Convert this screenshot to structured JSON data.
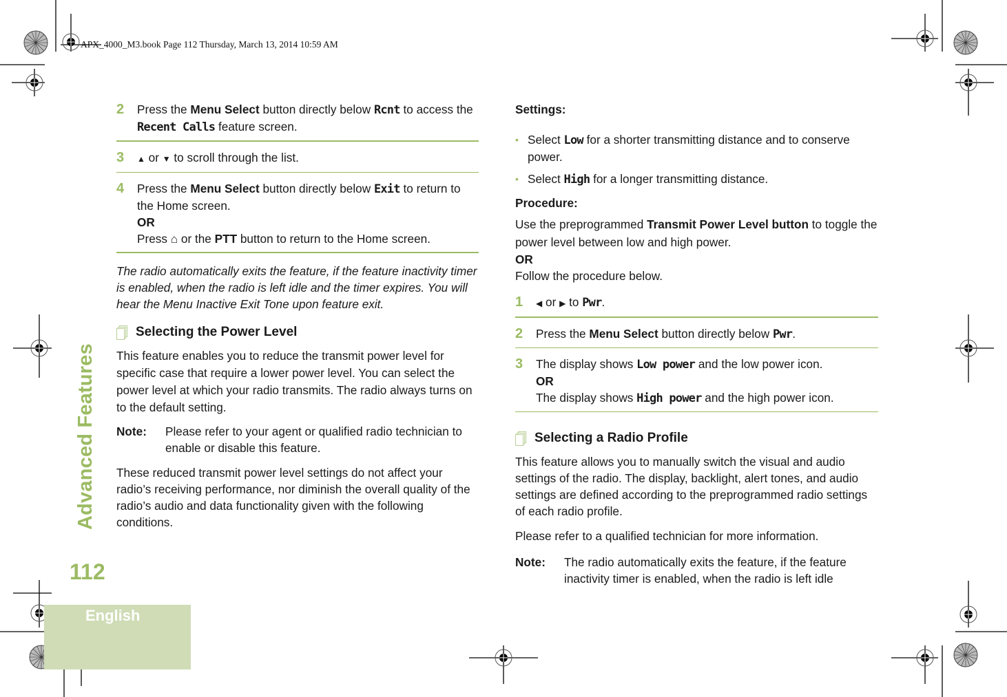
{
  "print_header": "APX_4000_M3.book  Page 112  Thursday, March 13, 2014  10:59 AM",
  "side_title": "Advanced Features",
  "page_number": "112",
  "language_tab": "English",
  "colors": {
    "accent_green": "#9bbb62",
    "lang_box": "#cfdcb6"
  },
  "left": {
    "steps": [
      {
        "num": "2",
        "parts": [
          "Press the ",
          "Menu Select",
          " button directly below ",
          "Rcnt",
          " to access the ",
          "Recent Calls",
          " feature screen."
        ]
      },
      {
        "num": "3",
        "up_icon": "▲",
        "or": " or ",
        "down_icon": "▼",
        "text": " to scroll through the list."
      },
      {
        "num": "4",
        "parts": [
          "Press the ",
          "Menu Select",
          " button directly below ",
          "Exit",
          " to return to the Home screen."
        ],
        "or_label": "OR",
        "alt_pre": "Press ",
        "home_icon": "⌂",
        "alt_mid": " or the ",
        "alt_bold": "PTT",
        "alt_post": " button to return to the Home screen."
      }
    ],
    "italic_note": "The radio automatically exits the feature, if the feature inactivity timer is enabled, when the radio is left idle and the timer expires. You will hear the Menu Inactive Exit Tone upon feature exit.",
    "section_heading": "Selecting the Power Level",
    "intro": "This feature enables you to reduce the transmit power level for specific case that require a lower power level. You can select the power level at which your radio transmits. The radio always turns on to the default setting.",
    "note_label": "Note:",
    "note_text": "Please refer to your agent or qualified radio technician to enable or disable this feature.",
    "closing": "These reduced transmit power level settings do not affect your radio’s receiving performance, nor diminish the overall quality of the radio’s audio and data functionality given with the following conditions."
  },
  "right": {
    "settings_label": "Settings:",
    "bullets": [
      {
        "pre": "Select ",
        "disp": "Low",
        "post": " for a shorter transmitting distance and to conserve power."
      },
      {
        "pre": "Select ",
        "disp": "High",
        "post": " for a longer transmitting distance."
      }
    ],
    "procedure_label": "Procedure:",
    "procedure_pre": "Use the preprogrammed ",
    "procedure_bold": "Transmit Power Level button",
    "procedure_post": " to toggle the power level between low and high power.",
    "or_label": "OR",
    "follow": "Follow the procedure below.",
    "steps": [
      {
        "num": "1",
        "left_icon": "◀",
        "or": " or ",
        "right_icon": "▶",
        "to": " to ",
        "disp": "Pwr",
        "end": "."
      },
      {
        "num": "2",
        "pre": "Press the ",
        "bold": "Menu Select",
        "mid": " button directly below ",
        "disp": "Pwr",
        "end": "."
      },
      {
        "num": "3",
        "pre": "The display shows ",
        "disp": "Low power",
        "post": " and the low power icon.",
        "or_label": "OR",
        "pre2": "The display shows ",
        "disp2": "High power",
        "post2": " and the high power icon."
      }
    ],
    "section_heading": "Selecting a Radio Profile",
    "intro": "This feature allows you to manually switch the visual and audio settings of the radio. The display, backlight, alert tones, and audio settings are defined according to the preprogrammed radio settings of each radio profile.",
    "refer": "Please refer to a qualified technician for more information.",
    "note_label": "Note:",
    "note_text": "The radio automatically exits the feature, if the feature inactivity timer is enabled, when the radio is left idle"
  }
}
